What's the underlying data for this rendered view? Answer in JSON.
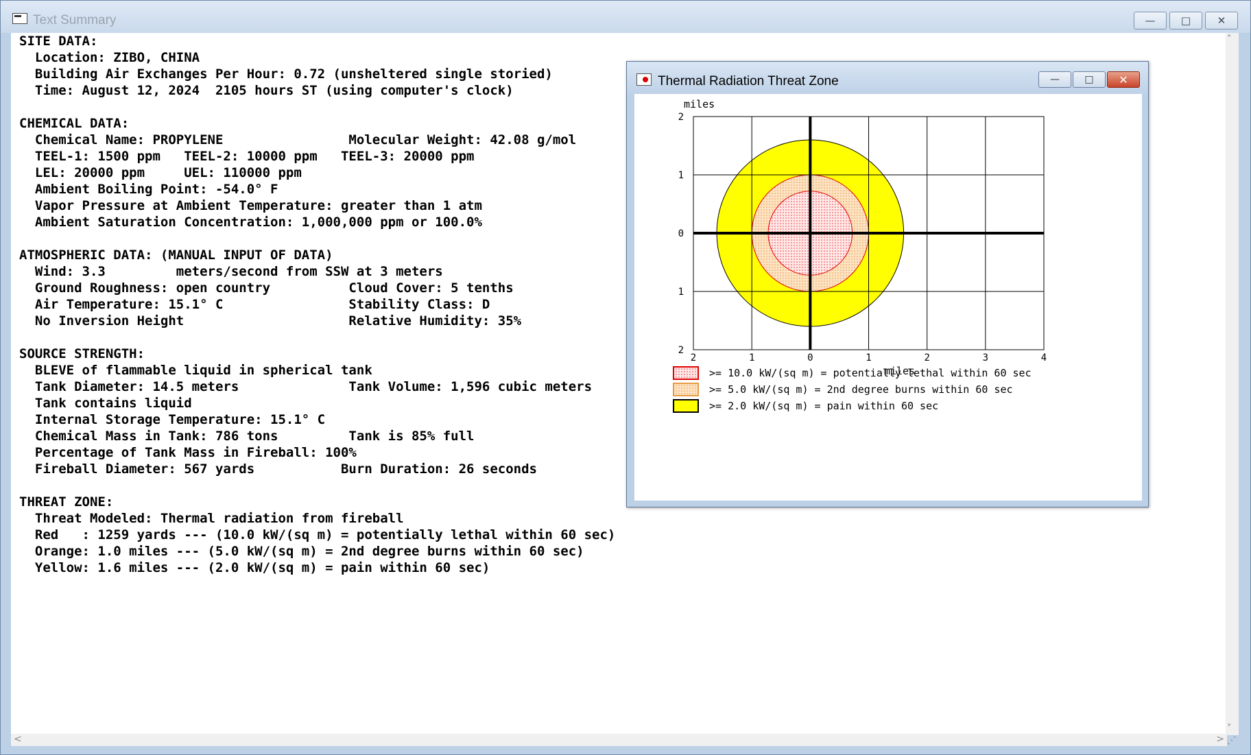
{
  "window": {
    "title": "Text Summary",
    "minimize_glyph": "—",
    "maximize_glyph": "□",
    "close_glyph": "✕"
  },
  "summary_lines": [
    "SITE DATA:",
    "  Location: ZIBO, CHINA",
    "  Building Air Exchanges Per Hour: 0.72 (unsheltered single storied)",
    "  Time: August 12, 2024  2105 hours ST (using computer's clock)",
    "",
    "CHEMICAL DATA:",
    "  Chemical Name: PROPYLENE                Molecular Weight: 42.08 g/mol",
    "  TEEL-1: 1500 ppm   TEEL-2: 10000 ppm   TEEL-3: 20000 ppm",
    "  LEL: 20000 ppm     UEL: 110000 ppm",
    "  Ambient Boiling Point: -54.0° F",
    "  Vapor Pressure at Ambient Temperature: greater than 1 atm",
    "  Ambient Saturation Concentration: 1,000,000 ppm or 100.0%",
    "",
    "ATMOSPHERIC DATA: (MANUAL INPUT OF DATA)",
    "  Wind: 3.3         meters/second from SSW at 3 meters",
    "  Ground Roughness: open country          Cloud Cover: 5 tenths",
    "  Air Temperature: 15.1° C                Stability Class: D",
    "  No Inversion Height                     Relative Humidity: 35%",
    "",
    "SOURCE STRENGTH:",
    "  BLEVE of flammable liquid in spherical tank",
    "  Tank Diameter: 14.5 meters              Tank Volume: 1,596 cubic meters",
    "  Tank contains liquid",
    "  Internal Storage Temperature: 15.1° C",
    "  Chemical Mass in Tank: 786 tons         Tank is 85% full",
    "  Percentage of Tank Mass in Fireball: 100%",
    "  Fireball Diameter: 567 yards           Burn Duration: 26 seconds",
    "",
    "THREAT ZONE:",
    "  Threat Modeled: Thermal radiation from fireball",
    "  Red   : 1259 yards --- (10.0 kW/(sq m) = potentially lethal within 60 sec)",
    "  Orange: 1.0 miles --- (5.0 kW/(sq m) = 2nd degree burns within 60 sec)",
    "  Yellow: 1.6 miles --- (2.0 kW/(sq m) = pain within 60 sec)"
  ],
  "scroll": {
    "up_arrow": "˄",
    "down_arrow": "˅",
    "left_arrow": "<",
    "right_arrow": ">",
    "grip": "⋰"
  },
  "chart_window": {
    "title": "Thermal Radiation Threat Zone",
    "minimize_glyph": "—",
    "maximize_glyph": "□",
    "close_glyph": "✕"
  },
  "colors": {
    "red_zone": "#e00000",
    "orange_zone": "#f7c27a",
    "yellow_zone": "#ffff00",
    "red_fill": "#ffe6e6"
  },
  "chart_data": {
    "type": "area",
    "xlabel": "miles",
    "ylabel": "miles",
    "x_ticks": [
      "2",
      "1",
      "0",
      "1",
      "2",
      "3",
      "4"
    ],
    "y_ticks": [
      "2",
      "1",
      "0",
      "1",
      "2"
    ],
    "x_tick_values": [
      -2,
      -1,
      0,
      1,
      2,
      3,
      4
    ],
    "y_tick_values": [
      2,
      1,
      0,
      -1,
      -2
    ],
    "xlim": [
      -2,
      4
    ],
    "ylim": [
      -2,
      2
    ],
    "grid": true,
    "zones": [
      {
        "name": "yellow",
        "radius_miles": 1.6,
        "color": "#ffff00"
      },
      {
        "name": "orange",
        "radius_miles": 1.0,
        "color": "#f7c27a"
      },
      {
        "name": "red",
        "radius_miles": 0.72,
        "color": "#e00000"
      }
    ],
    "legend": [
      {
        "label": ">= 10.0 kW/(sq m) = potentially lethal within 60 sec",
        "swatch": "red"
      },
      {
        "label": ">= 5.0 kW/(sq m) = 2nd degree burns within 60 sec",
        "swatch": "orange"
      },
      {
        "label": ">= 2.0 kW/(sq m) = pain within 60 sec",
        "swatch": "yellow"
      }
    ]
  }
}
